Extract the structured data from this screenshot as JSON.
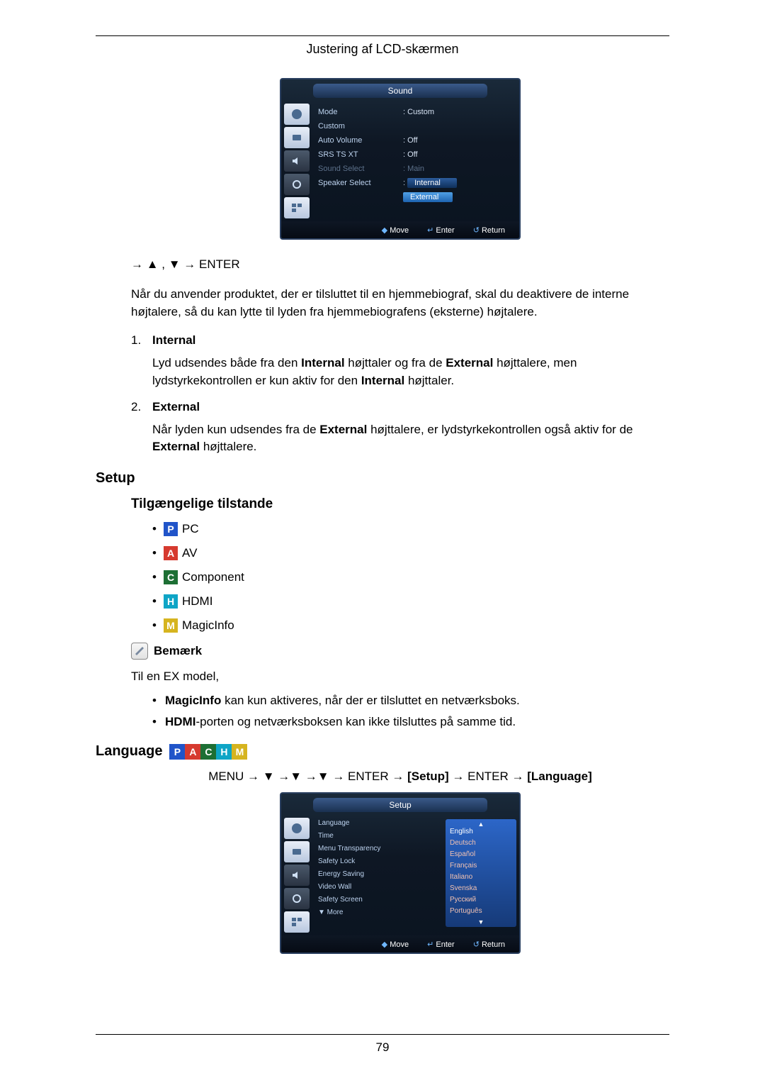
{
  "header": {
    "title": "Justering af LCD-skærmen"
  },
  "osd_sound": {
    "title": "Sound",
    "rows": [
      {
        "label": "Mode",
        "value": "Custom",
        "dim": false,
        "valdim": false
      },
      {
        "label": "Custom",
        "value": "",
        "dim": false,
        "valdim": false
      },
      {
        "label": "Auto Volume",
        "value": "Off",
        "dim": false,
        "valdim": false
      },
      {
        "label": "SRS TS XT",
        "value": "Off",
        "dim": false,
        "valdim": false
      },
      {
        "label": "Sound Select",
        "value": "Main",
        "dim": true,
        "valdim": true
      },
      {
        "label": "Speaker Select",
        "value": "",
        "dim": false,
        "valdim": false
      }
    ],
    "speaker_options": {
      "selected": "Internal",
      "other": "External"
    },
    "footer": {
      "move": "Move",
      "enter": "Enter",
      "return": "Return"
    }
  },
  "nav_sound": "→ ▲ , ▼ → ENTER",
  "intro_para": "Når du anvender produktet, der er tilsluttet til en hjemmebiograf, skal du deaktivere de interne højtalere, så du kan lytte til lyden fra hjemmebiografens (eksterne) højtalere.",
  "list_items": [
    {
      "num": "1.",
      "title": "Internal",
      "desc_parts": [
        "Lyd udsendes både fra den ",
        "Internal",
        " højttaler og fra de ",
        "External",
        " højttalere, men lydstyrkekontrollen er kun aktiv for den ",
        "Internal",
        " højttaler."
      ]
    },
    {
      "num": "2.",
      "title": "External",
      "desc_parts": [
        "Når lyden kun udsendes fra de ",
        "External",
        " højttalere, er lydstyrkekontrollen også aktiv for de ",
        "External",
        " højttalere."
      ]
    }
  ],
  "setup_heading": "Setup",
  "modes_heading": "Tilgængelige tilstande",
  "modes": [
    {
      "badge": "P",
      "cls": "p",
      "label": "PC"
    },
    {
      "badge": "A",
      "cls": "a",
      "label": "AV"
    },
    {
      "badge": "C",
      "cls": "c",
      "label": "Component"
    },
    {
      "badge": "H",
      "cls": "h",
      "label": "HDMI"
    },
    {
      "badge": "M",
      "cls": "m",
      "label": "MagicInfo"
    }
  ],
  "note_label": "Bemærk",
  "note_intro": "Til en EX model,",
  "note_bullets": [
    {
      "bold": "MagicInfo",
      "rest": " kan kun aktiveres, når der er tilsluttet en netværksboks."
    },
    {
      "bold": "HDMI",
      "rest": "-porten og netværksboksen kan ikke tilsluttes på samme tid."
    }
  ],
  "language_heading": "Language",
  "badges_strip": [
    {
      "t": "P",
      "c": "p"
    },
    {
      "t": "A",
      "c": "a"
    },
    {
      "t": "C",
      "c": "c"
    },
    {
      "t": "H",
      "c": "h"
    },
    {
      "t": "M",
      "c": "m"
    }
  ],
  "menu_path": {
    "pre": "MENU → ▼ →▼ →▼ → ENTER → ",
    "setup": "[Setup]",
    "mid": " → ENTER → ",
    "lang": "[Language]"
  },
  "osd_setup": {
    "title": "Setup",
    "left": [
      "Language",
      "Time",
      "Menu Transparency",
      "Safety Lock",
      "Energy Saving",
      "Video Wall",
      "Safety Screen"
    ],
    "more": "▼ More",
    "languages": [
      "English",
      "Deutsch",
      "Español",
      "Français",
      "Italiano",
      "Svenska",
      "Русский",
      "Português"
    ],
    "footer": {
      "move": "Move",
      "enter": "Enter",
      "return": "Return"
    }
  },
  "page_number": "79"
}
